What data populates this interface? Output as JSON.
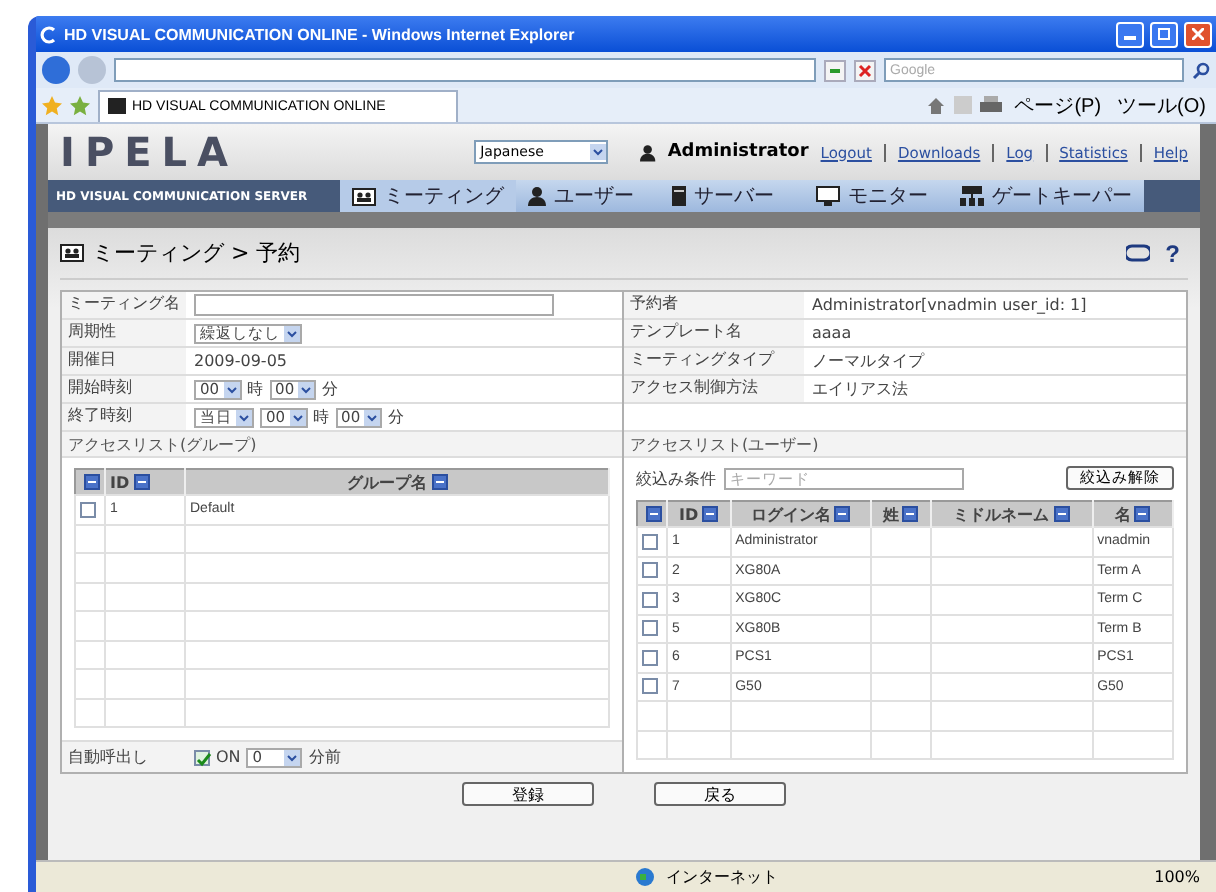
{
  "browser": {
    "title": "HD VISUAL COMMUNICATION ONLINE - Windows Internet Explorer",
    "search": {
      "placeholder": "Google"
    },
    "tab": "HD VISUAL COMMUNICATION ONLINE",
    "toolbar": [
      "ページ(P)",
      "ツール(O)"
    ]
  },
  "header": {
    "logo": "IPELA",
    "language": "Japanese",
    "user": "Administrator",
    "links": [
      "Logout",
      "Downloads",
      "Log",
      "Statistics",
      "Help"
    ]
  },
  "nav": {
    "brand": "HD VISUAL COMMUNICATION SERVER",
    "items": [
      {
        "label": "ミーティング",
        "kind": "meeting",
        "selected": true
      },
      {
        "label": "ユーザー",
        "kind": "user",
        "selected": false
      },
      {
        "label": "サーバー",
        "kind": "server",
        "selected": false
      },
      {
        "label": "モニター",
        "kind": "monitor",
        "selected": false
      },
      {
        "label": "ゲートキーパー",
        "kind": "gatekeeper",
        "selected": false
      }
    ]
  },
  "page": {
    "title": "ミーティング > 予約",
    "help": "?"
  },
  "left_fields": [
    {
      "label": "ミーティング名",
      "parts": [
        {
          "kind": "input"
        }
      ]
    },
    {
      "label": "周期性",
      "parts": [
        {
          "kind": "select",
          "value": "繰返しなし"
        }
      ]
    },
    {
      "label": "開催日",
      "parts": [
        {
          "kind": "text",
          "value": "2009-09-05"
        }
      ]
    },
    {
      "label": "開始時刻",
      "parts": [
        {
          "kind": "select",
          "value": "00"
        },
        {
          "kind": "text",
          "value": "時"
        },
        {
          "kind": "select",
          "value": "00"
        },
        {
          "kind": "text",
          "value": "分"
        }
      ]
    },
    {
      "label": "終了時刻",
      "parts": [
        {
          "kind": "select",
          "value": "当日"
        },
        {
          "kind": "select",
          "value": "00"
        },
        {
          "kind": "text",
          "value": "時"
        },
        {
          "kind": "select",
          "value": "00"
        },
        {
          "kind": "text",
          "value": "分"
        }
      ]
    }
  ],
  "group_access": {
    "title": "アクセスリスト(グループ)",
    "columns": [
      "ID",
      "グループ名"
    ],
    "rows": [
      {
        "checked": false,
        "cells": [
          "1",
          "Default"
        ]
      }
    ]
  },
  "auto_call": {
    "label": "自動呼出し",
    "checked": true,
    "option": "ON",
    "minutes": "0",
    "unit": "分前"
  },
  "right_fields": [
    {
      "label": "予約者",
      "value": "Administrator[vnadmin user_id: 1]"
    },
    {
      "label": "テンプレート名",
      "value": "aaaa"
    },
    {
      "label": "ミーティングタイプ",
      "value": "ノーマルタイプ"
    },
    {
      "label": "アクセス制御方法",
      "value": "エイリアス法"
    }
  ],
  "user_access": {
    "title": "アクセスリスト(ユーザー)",
    "filter_label": "絞込み条件",
    "filter": {
      "placeholder": "キーワード"
    },
    "clear_button": "絞込み解除",
    "columns": [
      "ID",
      "ログイン名",
      "姓",
      "ミドルネーム",
      "名"
    ],
    "rows": [
      {
        "checked": false,
        "cells": [
          "1",
          "Administrator",
          "",
          "",
          "vnadmin"
        ]
      },
      {
        "checked": false,
        "cells": [
          "2",
          "XG80A",
          "",
          "",
          "Term A"
        ]
      },
      {
        "checked": false,
        "cells": [
          "3",
          "XG80C",
          "",
          "",
          "Term C"
        ]
      },
      {
        "checked": false,
        "cells": [
          "5",
          "XG80B",
          "",
          "",
          "Term B"
        ]
      },
      {
        "checked": false,
        "cells": [
          "6",
          "PCS1",
          "",
          "",
          "PCS1"
        ]
      },
      {
        "checked": false,
        "cells": [
          "7",
          "G50",
          "",
          "",
          "G50"
        ]
      }
    ]
  },
  "buttons": [
    "登録",
    "戻る"
  ],
  "status_bar": {
    "zone": "インターネット",
    "zoom": "100%"
  }
}
